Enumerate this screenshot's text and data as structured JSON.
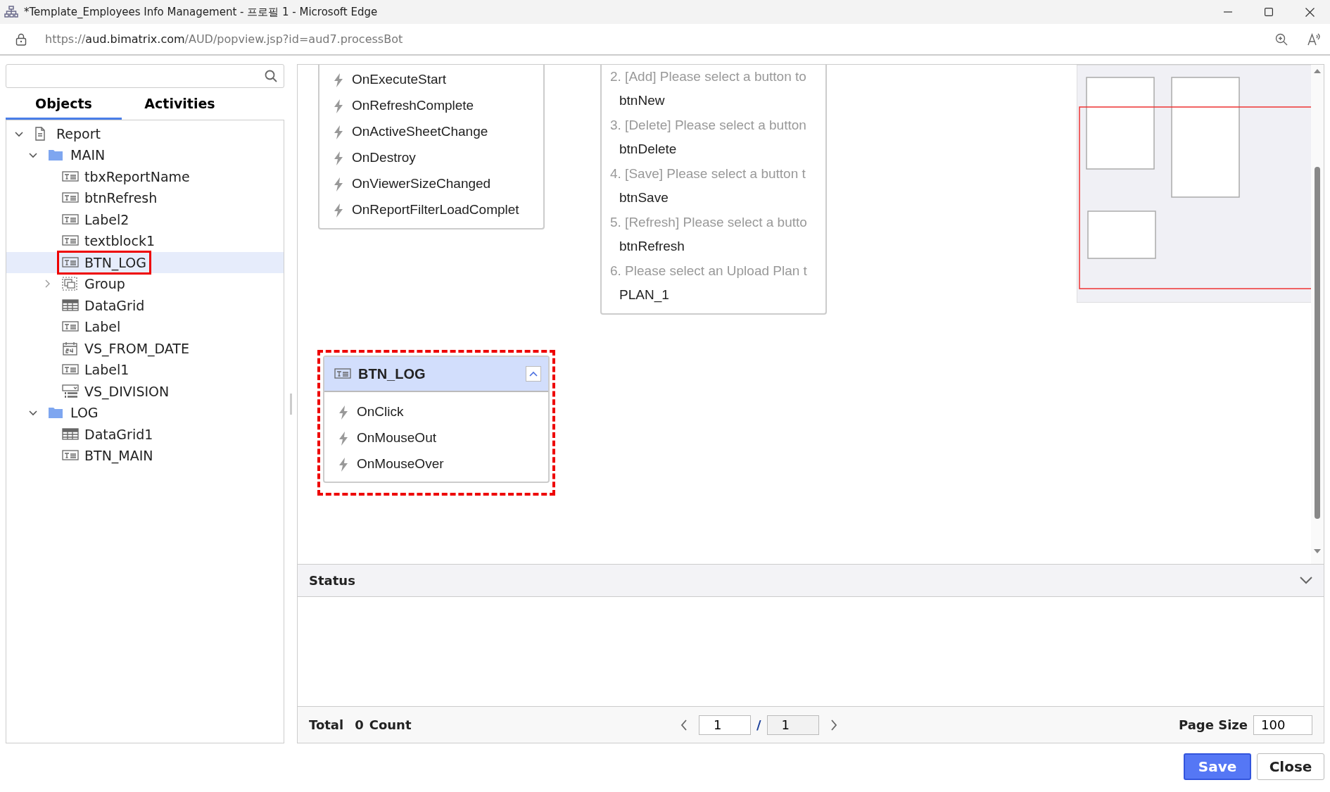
{
  "window": {
    "title": "*Template_Employees Info Management - 프로필 1 - Microsoft Edge",
    "url": {
      "scheme": "https://",
      "host": "aud.bimatrix.com",
      "path": "/AUD/popview.jsp?id=aud7.processBot"
    }
  },
  "sidebar": {
    "tabs": [
      {
        "label": "Objects",
        "selected": true
      },
      {
        "label": "Activities",
        "selected": false
      }
    ],
    "tree": [
      {
        "label": "Report",
        "kind": "report",
        "expanded": true,
        "selected": false,
        "outlined": false,
        "children": [
          {
            "label": "MAIN",
            "kind": "folder",
            "expanded": true,
            "selected": false,
            "outlined": false,
            "children": [
              {
                "label": "tbxReportName",
                "kind": "text",
                "selected": false,
                "outlined": false
              },
              {
                "label": "btnRefresh",
                "kind": "text",
                "selected": false,
                "outlined": false
              },
              {
                "label": "Label2",
                "kind": "text",
                "selected": false,
                "outlined": false
              },
              {
                "label": "textblock1",
                "kind": "text",
                "selected": false,
                "outlined": false
              },
              {
                "label": "BTN_LOG",
                "kind": "text",
                "selected": true,
                "outlined": true
              },
              {
                "label": "Group",
                "kind": "group",
                "expanded": false,
                "selected": false,
                "outlined": false
              },
              {
                "label": "DataGrid",
                "kind": "grid",
                "selected": false,
                "outlined": false
              },
              {
                "label": "Label",
                "kind": "text",
                "selected": false,
                "outlined": false
              },
              {
                "label": "VS_FROM_DATE",
                "kind": "date",
                "selected": false,
                "outlined": false
              },
              {
                "label": "Label1",
                "kind": "text",
                "selected": false,
                "outlined": false
              },
              {
                "label": "VS_DIVISION",
                "kind": "combo",
                "selected": false,
                "outlined": false
              }
            ]
          },
          {
            "label": "LOG",
            "kind": "folder",
            "expanded": true,
            "selected": false,
            "outlined": false,
            "children": [
              {
                "label": "DataGrid1",
                "kind": "grid",
                "selected": false,
                "outlined": false
              },
              {
                "label": "BTN_MAIN",
                "kind": "text",
                "selected": false,
                "outlined": false
              }
            ]
          }
        ]
      }
    ]
  },
  "canvas": {
    "cards": [
      {
        "kind": "events",
        "outlined": false,
        "events": [
          "OnExecuteStart",
          "OnRefreshComplete",
          "OnActiveSheetChange",
          "OnDestroy",
          "OnViewerSizeChanged",
          "OnReportFilterLoadComplet"
        ]
      },
      {
        "kind": "steps",
        "outlined": false,
        "steps": [
          {
            "prompt": "2. [Add] Please select a button to",
            "value": "btnNew"
          },
          {
            "prompt": "3. [Delete] Please select a button",
            "value": "btnDelete"
          },
          {
            "prompt": "4. [Save] Please select a button t",
            "value": "btnSave"
          },
          {
            "prompt": "5. [Refresh] Please select a butto",
            "value": "btnRefresh"
          },
          {
            "prompt": "6. Please select an Upload Plan t",
            "value": "PLAN_1"
          }
        ]
      },
      {
        "kind": "events",
        "title": "BTN_LOG",
        "outlined": true,
        "events": [
          "OnClick",
          "OnMouseOut",
          "OnMouseOver"
        ]
      }
    ]
  },
  "status": {
    "title": "Status",
    "total_label": "Total",
    "count": "0",
    "count_label": "Count",
    "page": "1",
    "separator": "/",
    "pages": "1",
    "page_size_label": "Page Size",
    "page_size": "100"
  },
  "buttons": [
    {
      "label": "Save",
      "kind": "primary"
    },
    {
      "label": "Close",
      "kind": "secondary"
    }
  ]
}
